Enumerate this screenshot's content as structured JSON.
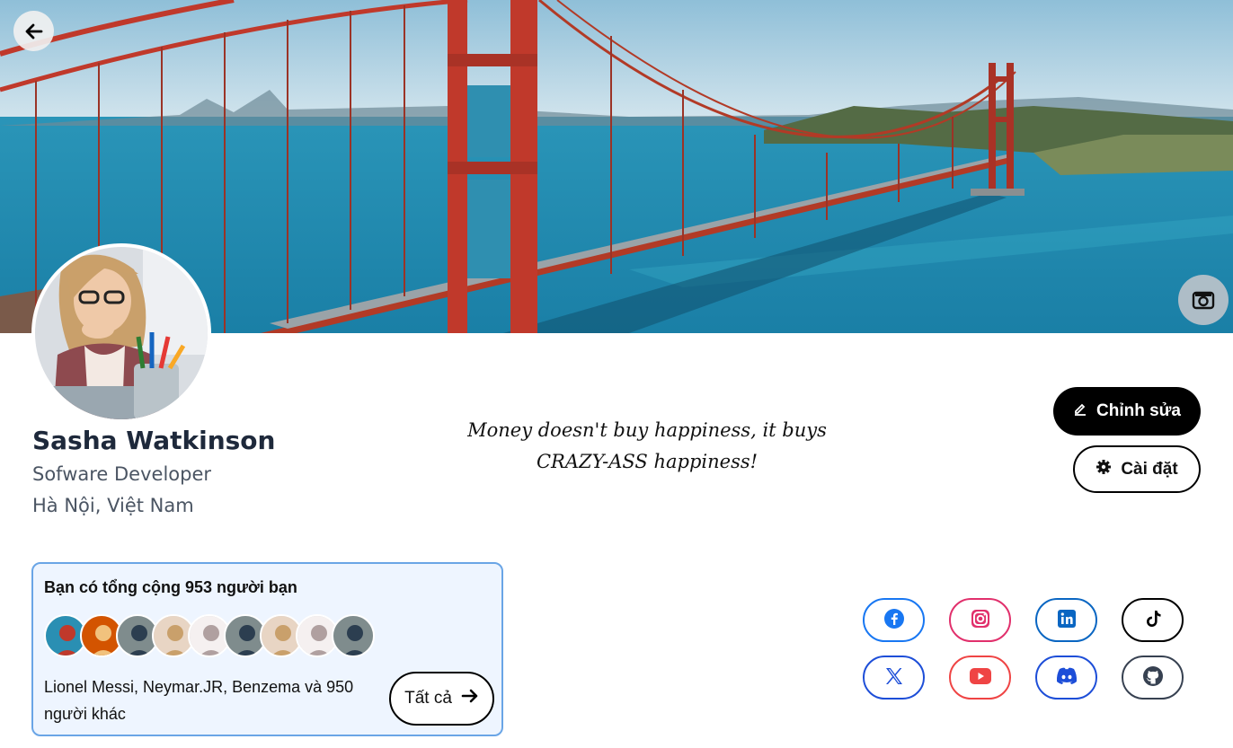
{
  "profile": {
    "name": "Sasha Watkinson",
    "job_title": "Sofware Developer",
    "location": "Hà Nội, Việt Nam"
  },
  "quote": {
    "line1": "Money doesn't buy happiness, it buys",
    "line2": "CRAZY-ASS happiness!"
  },
  "actions": {
    "edit_label": "Chỉnh sửa",
    "settings_label": "Cài đặt"
  },
  "friends": {
    "title": "Bạn có tổng cộng 953 người bạn",
    "names_text": "Lionel Messi, Neymar.JR, Benzema và 950 người khác",
    "all_label": "Tất cả",
    "avatar_count": 9
  },
  "socials": [
    {
      "name": "facebook",
      "color": "#1877f2"
    },
    {
      "name": "instagram",
      "color": "#e1306c"
    },
    {
      "name": "linkedin",
      "color": "#0a66c2"
    },
    {
      "name": "tiktok",
      "color": "#000000"
    },
    {
      "name": "x",
      "color": "#1d4ed8"
    },
    {
      "name": "youtube",
      "color": "#ef4444"
    },
    {
      "name": "discord",
      "color": "#1d4ed8"
    },
    {
      "name": "github",
      "color": "#374151"
    }
  ],
  "icons": {
    "back": "arrow-left-icon",
    "camera": "camera-icon",
    "edit": "pencil-icon",
    "settings": "gear-icon",
    "all": "arrow-right-icon"
  }
}
